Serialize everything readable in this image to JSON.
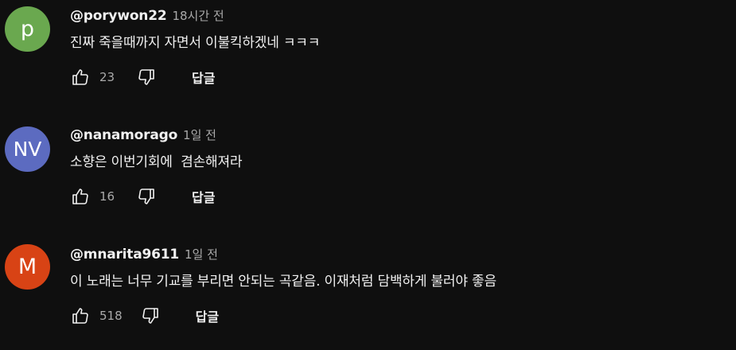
{
  "comments": [
    {
      "avatar_letter": "p",
      "avatar_color": "#6aa84f",
      "author": "@porywon22",
      "time": "18시간 전",
      "text": "진짜 죽을때까지 자면서 이불킥하겠네 ㅋㅋㅋ",
      "likes": "23",
      "reply_label": "답글"
    },
    {
      "avatar_letter": "NV",
      "avatar_color": "#5c6bc0",
      "author": "@nanamorago",
      "time": "1일 전",
      "text": "소향은 이번기회에  겸손해져라",
      "likes": "16",
      "reply_label": "답글"
    },
    {
      "avatar_letter": "M",
      "avatar_color": "#d84315",
      "author": "@mnarita9611",
      "time": "1일 전",
      "text": "이 노래는 너무 기교를 부리면 안되는 곡같음. 이재처럼 담백하게 불러야 좋음",
      "likes": "518",
      "reply_label": "답글"
    }
  ],
  "icons": {
    "like": "thumbs-up-icon",
    "dislike": "thumbs-down-icon"
  }
}
